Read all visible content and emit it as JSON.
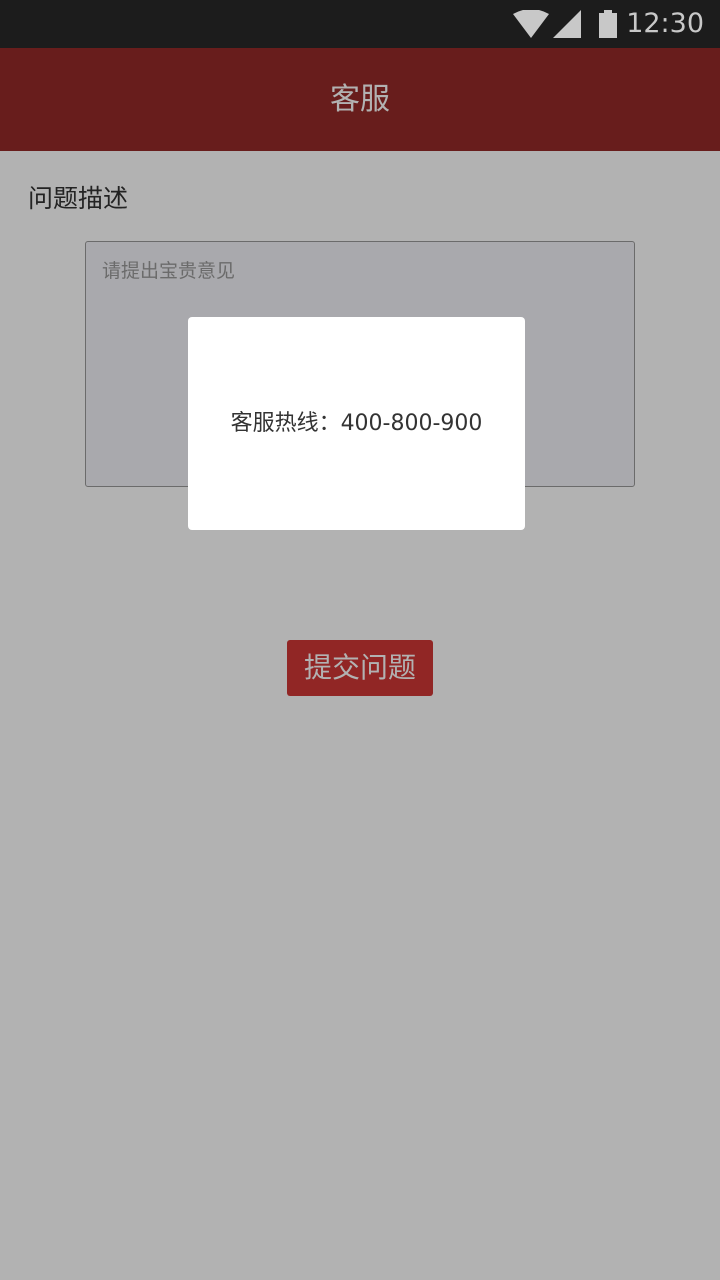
{
  "status_bar": {
    "time": "12:30",
    "icons": [
      "wifi-icon",
      "signal-icon",
      "battery-icon"
    ]
  },
  "app_bar": {
    "title": "客服",
    "color": "#952a29"
  },
  "form": {
    "section_label": "问题描述",
    "feedback_placeholder": "请提出宝贵意见",
    "submit_label": "提交问题",
    "submit_color": "#d03736"
  },
  "dialog": {
    "message": "客服热线：400-800-900"
  }
}
